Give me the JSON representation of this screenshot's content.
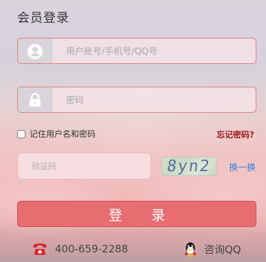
{
  "form": {
    "title": "会员登录",
    "username_placeholder": "用户账号/手机号/QQ号",
    "password_placeholder": "密码",
    "remember_label": "记住用户名和密码",
    "forgot_label": "忘记密码?",
    "captcha_placeholder": "验证码",
    "captcha_text": "8yn2",
    "refresh_label": "换一换",
    "submit_label": "登 录"
  },
  "footer": {
    "phone": "400-659-2288",
    "qq_label": "咨询QQ"
  },
  "colors": {
    "accent": "#e86d71",
    "link": "#2c82d7",
    "forgot": "#9b1d1d"
  },
  "icons": {
    "username": "user-icon",
    "password": "lock-icon",
    "phone": "phone-icon",
    "qq": "qq-icon"
  }
}
